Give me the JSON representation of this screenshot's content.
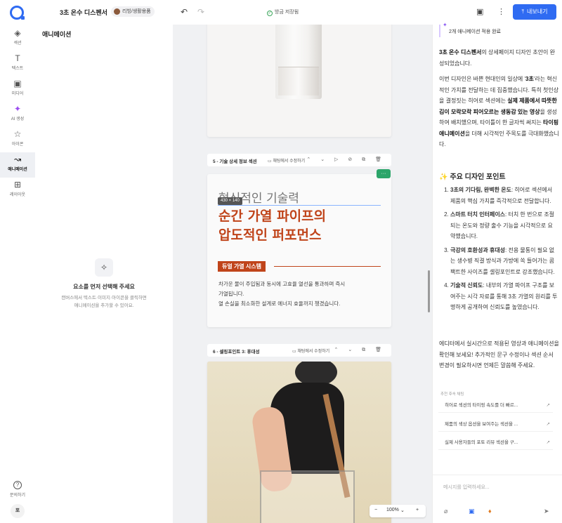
{
  "topbar": {
    "project_title": "3초 온수 디스펜서",
    "category_tag": "리빙/생활용품",
    "undo_icon": "↶",
    "redo_icon": "↷",
    "save_status": "방금 저장됨",
    "export_label": "내보내기"
  },
  "rail": {
    "items": [
      {
        "icon": "◈",
        "label": "섹션"
      },
      {
        "icon": "T",
        "label": "텍스트"
      },
      {
        "icon": "▣",
        "label": "미디어"
      },
      {
        "icon": "✦",
        "label": "AI 생성"
      },
      {
        "icon": "☆",
        "label": "아이콘"
      },
      {
        "icon": "↝",
        "label": "애니메이션"
      },
      {
        "icon": "⊞",
        "label": "레이아웃"
      }
    ],
    "help_label": "문의하기",
    "avatar_text": "포"
  },
  "anim_panel": {
    "title": "애니메이션",
    "empty_icon": "✧",
    "empty_title": "요소를 먼저 선택해 주세요",
    "empty_desc_1": "캔버스에서 텍스트·이미지·아이콘을 클릭하면",
    "empty_desc_2": "애니메이션을 추가할 수 있어요."
  },
  "canvas": {
    "section5": {
      "number_title": "5 - 기술 상세 정보 섹션",
      "edit_label": "채팅에서 수정하기",
      "tools": "⌃ ⌄ ▷ ⊘ ⧉ 🗑",
      "dim_badge": "430 × 140",
      "heading_light": "혁신적인 기술력",
      "heading_bold_1": "순간 가열 파이프의",
      "heading_bold_2": "압도적인 퍼포먼스",
      "badge": "듀얼 가열 시스템",
      "body_1": "차가운 물이 주입됨과 동시에 고효율 열선을 통과하며 즉시",
      "body_2": "가열됩니다.",
      "body_3": "열 손실을 최소화한 설계로 에너지 효율까지 챙겼습니다."
    },
    "section6": {
      "number_title": "6 - 셀링포인트 3: 휴대성",
      "edit_label": "채팅에서 수정하기",
      "tools": "⌃ ⌄ ⧉ 🗑"
    },
    "zoom": {
      "minus": "−",
      "value": "100%",
      "caret": "⌄",
      "plus": "+"
    },
    "green_tag": "···"
  },
  "chat": {
    "status": "2개 애니메이션 적용 완료",
    "intro_bold": "3초 온수 디스펜서",
    "intro_rest": "의 상세페이지 디자인 초안이 완성되었습니다.",
    "p2_a": "이번 디자인은 바쁜 현대인의 일상에 '",
    "p2_b": "3초",
    "p2_c": "'라는 혁신적인 가치를 전달하는 데 집중했습니다. 특히 첫인상을 결정짓는 히어로 섹션에는 ",
    "p2_d": "실제 제품에서 따뜻한 김이 모락모락 피어오르는 생동감 있는 영상",
    "p2_e": "을 생성하여 배치했으며, 타이틀이 한 글자씩 써지는 ",
    "p2_f": "타이핑 애니메이션",
    "p2_g": "을 더해 시각적인 주목도를 극대화했습니다.",
    "points_title": "주요 디자인 포인트",
    "points": [
      {
        "bold": "3초의 기다림, 완벽한 온도",
        "text": ": 히어로 섹션에서 제품의 핵심 가치를 즉각적으로 전달합니다."
      },
      {
        "bold": "스마트 터치 인터페이스",
        "text": ": 터치 한 번으로 조절되는 온도와 정량 출수 기능을 시각적으로 요약했습니다."
      },
      {
        "bold": "극강의 호환성과 휴대성",
        "text": ": 전용 물통이 필요 없는 생수병 직결 방식과 가방에 쏙 들어가는 콤팩트한 사이즈를 셀링포인트로 강조했습니다."
      },
      {
        "bold": "기술적 신뢰도",
        "text": ": 내부의 가열 파이프 구조를 보여주는 시각 자료를 통해 3초 가열의 원리를 투명하게 공개하여 신뢰도를 높였습니다."
      }
    ],
    "closing": "에디터에서 실시간으로 적용된 영상과 애니메이션을 확인해 보세요! 추가적인 문구 수정이나 섹션 순서 변경이 필요하시면 언제든 말씀해 주세요.",
    "suggest_title": "추천 후속 채팅",
    "suggestions": [
      "히어로 섹션의 타이핑 속도를 더 빠르...",
      "제품의 색상 옵션을 보여주는 섹션을 ...",
      "실제 사용자들의 포토 리뷰 섹션을 구..."
    ],
    "input_placeholder": "메시지를 입력하세요..."
  }
}
